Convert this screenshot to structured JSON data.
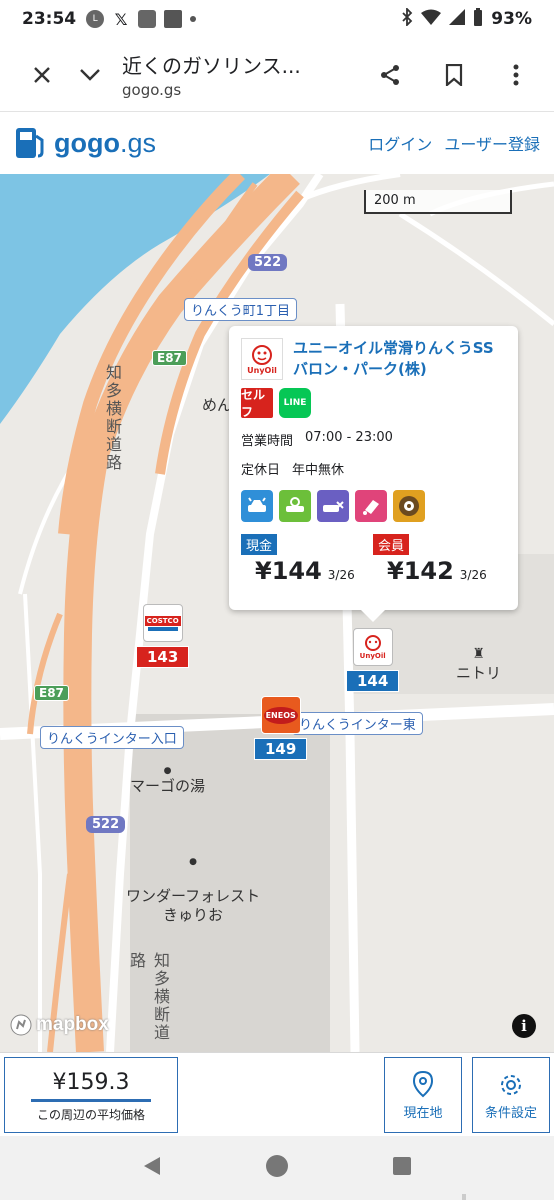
{
  "status_bar": {
    "time": "23:54",
    "battery": "93%"
  },
  "browser": {
    "page_title": "近くのガソリンス...",
    "domain": "gogo.gs"
  },
  "site": {
    "logo_text_main": "gogo",
    "logo_text_suffix": ".gs",
    "login_link": "ログイン",
    "register_link": "ユーザー登録"
  },
  "map": {
    "scale_label": "200 m",
    "road_labels": {
      "rinku_1": "りんくう町1丁目",
      "rinku_iriguchi": "りんくうインター入口",
      "rinku_east": "りんくうインター東"
    },
    "shields": {
      "r522_top": "522",
      "r522_bottom": "522",
      "e87_top": "E87",
      "e87_bottom": "E87"
    },
    "vertical_texts": {
      "chita_top": "知多横断道路",
      "chita_bottom": "知多横断道路"
    },
    "pois": {
      "men": "めん",
      "nitori": "ニトリ",
      "margo": "マーゴの湯",
      "wonder": "ワンダーフォレスト\nきゅりお"
    },
    "attribution": "mapbox"
  },
  "popup": {
    "station_name": "ユニーオイル常滑りんくうSS",
    "station_operator": "バロン・パーク(株)",
    "brand_logo": "UnyOil",
    "badge_self": "セルフ",
    "badge_line": "LINE",
    "hours_label": "営業時間",
    "hours_value": "07:00 - 23:00",
    "holiday_label": "定休日",
    "holiday_value": "年中無休",
    "services": [
      "car-wash-icon",
      "inspection-icon",
      "maintenance-icon",
      "oil-change-icon",
      "tire-icon"
    ],
    "cash_label": "現金",
    "cash_price": "¥144",
    "cash_date": "3/26",
    "member_label": "会員",
    "member_price": "¥142",
    "member_date": "3/26"
  },
  "markers": [
    {
      "brand": "COSTCO",
      "price": "143",
      "price_color": "#d7231d"
    },
    {
      "brand": "UnyOil",
      "price": "144",
      "price_color": "#1a6fb8"
    },
    {
      "brand": "ENEOS",
      "price": "149",
      "price_color": "#1a6fb8"
    }
  ],
  "bottom_panel": {
    "avg_price": "¥159.3",
    "avg_label": "この周辺の平均価格",
    "location_button": "現在地",
    "settings_button": "条件設定"
  },
  "colors": {
    "brand_blue": "#1a6fb8",
    "highway": "#f4b78a",
    "water": "#7dc4e4",
    "cash": "#1a6fb8",
    "member": "#d7231d"
  }
}
